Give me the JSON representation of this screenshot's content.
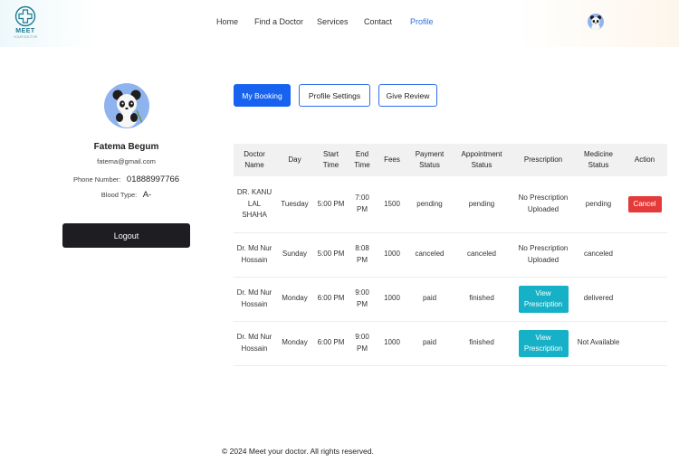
{
  "brand": {
    "name": "MEET",
    "tagline": "YOUR DOCTOR"
  },
  "nav": {
    "items": [
      {
        "label": "Home"
      },
      {
        "label": "Find a Doctor"
      },
      {
        "label": "Services"
      },
      {
        "label": "Contact"
      },
      {
        "label": "Profile",
        "active": true
      }
    ]
  },
  "profile": {
    "name": "Fatema Begum",
    "email": "fatema@gmail.com",
    "phone_label": "Phone Number:",
    "phone": "01888997766",
    "blood_label": "Blood Type:",
    "blood": "A-",
    "logout_label": "Logout"
  },
  "tabs": {
    "my_booking": "My Booking",
    "profile_settings": "Profile Settings",
    "give_review": "Give Review"
  },
  "table": {
    "headers": {
      "doctor": "Doctor Name",
      "day": "Day",
      "start": "Start Time",
      "end": "End Time",
      "fees": "Fees",
      "payment": "Payment Status",
      "appointment": "Appointment Status",
      "prescription": "Prescription",
      "medicine": "Medicine Status",
      "action": "Action"
    },
    "rows": [
      {
        "doctor": "DR. KANU LAL SHAHA",
        "day": "Tuesday",
        "start": "5:00 PM",
        "end": "7:00 PM",
        "fees": "1500",
        "payment": "pending",
        "appointment": "pending",
        "prescription": "No Prescription Uploaded",
        "medicine": "pending",
        "action": "Cancel"
      },
      {
        "doctor": "Dr. Md Nur Hossain",
        "day": "Sunday",
        "start": "5:00 PM",
        "end": "8:08 PM",
        "fees": "1000",
        "payment": "canceled",
        "appointment": "canceled",
        "prescription": "No Prescription Uploaded",
        "medicine": "canceled",
        "action": ""
      },
      {
        "doctor": "Dr. Md Nur Hossain",
        "day": "Monday",
        "start": "6:00 PM",
        "end": "9:00 PM",
        "fees": "1000",
        "payment": "paid",
        "appointment": "finished",
        "prescription": "View Prescription",
        "medicine": "delivered",
        "action": ""
      },
      {
        "doctor": "Dr. Md Nur Hossain",
        "day": "Monday",
        "start": "6:00 PM",
        "end": "9:00 PM",
        "fees": "1000",
        "payment": "paid",
        "appointment": "finished",
        "prescription": "View Prescription",
        "medicine": "Not Available",
        "action": ""
      }
    ]
  },
  "footer": {
    "text": "© 2024 Meet your doctor. All rights reserved."
  },
  "colors": {
    "accent": "#1763f0",
    "pending": "#e39b1f",
    "canceled": "#e53a3a",
    "success": "#2ea84f",
    "view_button": "#17b1c7",
    "logout": "#1d1d22"
  },
  "icons": {
    "logo": "stethoscope-cross-logo-icon",
    "avatar": "panda-avatar-icon"
  }
}
